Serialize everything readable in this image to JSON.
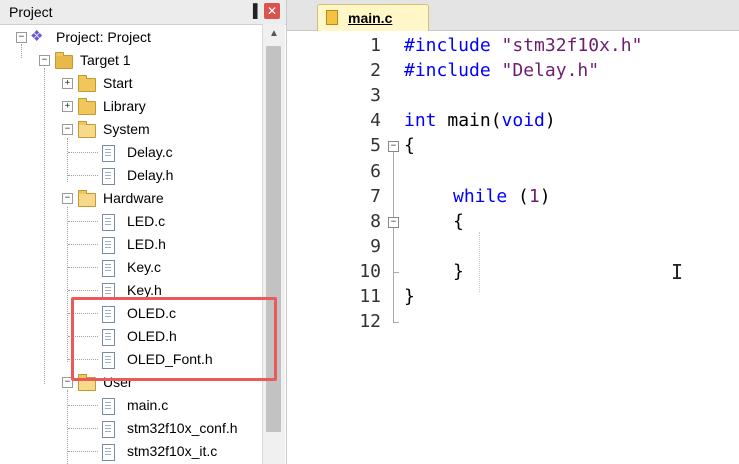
{
  "project_pane": {
    "title": "Project",
    "pin_glyph": "▐",
    "close_glyph": "✕",
    "tree": [
      {
        "label": "Project: Project",
        "type": "project",
        "expander": "−"
      },
      {
        "label": "Target 1",
        "type": "target",
        "expander": "−"
      },
      {
        "label": "Start",
        "type": "folder",
        "expander": "+"
      },
      {
        "label": "Library",
        "type": "folder",
        "expander": "+"
      },
      {
        "label": "System",
        "type": "folder",
        "expander": "−"
      },
      {
        "label": "Delay.c",
        "type": "file"
      },
      {
        "label": "Delay.h",
        "type": "file"
      },
      {
        "label": "Hardware",
        "type": "folder",
        "expander": "−"
      },
      {
        "label": "LED.c",
        "type": "file"
      },
      {
        "label": "LED.h",
        "type": "file"
      },
      {
        "label": "Key.c",
        "type": "file"
      },
      {
        "label": "Key.h",
        "type": "file"
      },
      {
        "label": "OLED.c",
        "type": "file"
      },
      {
        "label": "OLED.h",
        "type": "file"
      },
      {
        "label": "OLED_Font.h",
        "type": "file"
      },
      {
        "label": "User",
        "type": "folder",
        "expander": "−"
      },
      {
        "label": "main.c",
        "type": "file"
      },
      {
        "label": "stm32f10x_conf.h",
        "type": "file"
      },
      {
        "label": "stm32f10x_it.c",
        "type": "file"
      }
    ]
  },
  "editor": {
    "active_tab": "main.c",
    "line_numbers": [
      "1",
      "2",
      "3",
      "4",
      "5",
      "6",
      "7",
      "8",
      "9",
      "10",
      "11",
      "12"
    ],
    "code": {
      "l1_pp": "#include",
      "l1_str": "\"stm32f10x.h\"",
      "l2_pp": "#include",
      "l2_str": "\"Delay.h\"",
      "l4_kw1": "int",
      "l4_mid": " main(",
      "l4_kw2": "void",
      "l4_end": ")",
      "l5": "{",
      "l7_kw": "while",
      "l7_open": " (",
      "l7_num": "1",
      "l7_close": ")",
      "l8": "{",
      "l10": "}",
      "l11": "}"
    },
    "fold_glyph": "−",
    "cursor_glyph": "I"
  },
  "colors": {
    "highlight_box": "#ea5a5a",
    "keyword": "#0000ff",
    "string": "#6e1d73",
    "tab_active": "#fff7c8"
  }
}
